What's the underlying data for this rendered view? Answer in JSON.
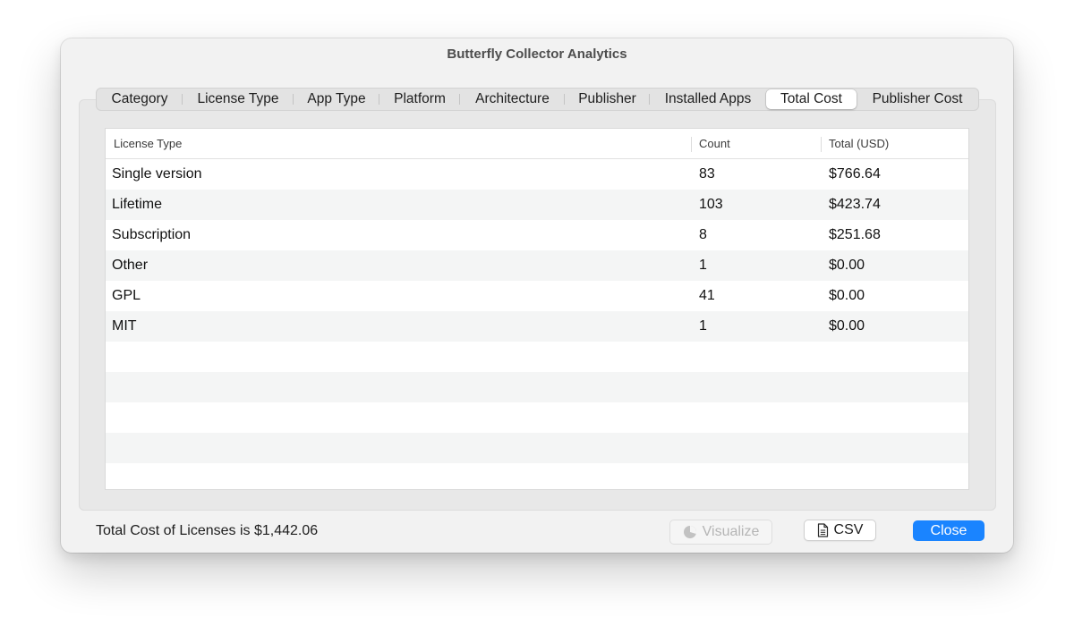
{
  "window": {
    "title": "Butterfly Collector Analytics"
  },
  "tabs": [
    {
      "label": "Category",
      "active": false
    },
    {
      "label": "License Type",
      "active": false
    },
    {
      "label": "App Type",
      "active": false
    },
    {
      "label": "Platform",
      "active": false
    },
    {
      "label": "Architecture",
      "active": false
    },
    {
      "label": "Publisher",
      "active": false
    },
    {
      "label": "Installed Apps",
      "active": false
    },
    {
      "label": "Total Cost",
      "active": true
    },
    {
      "label": "Publisher Cost",
      "active": false
    }
  ],
  "table": {
    "columns": [
      "License Type",
      "Count",
      "Total (USD)"
    ],
    "rows": [
      [
        "Single version",
        "83",
        "$766.64"
      ],
      [
        "Lifetime",
        "103",
        "$423.74"
      ],
      [
        "Subscription",
        "8",
        "$251.68"
      ],
      [
        "Other",
        "1",
        "$0.00"
      ],
      [
        "GPL",
        "41",
        "$0.00"
      ],
      [
        "MIT",
        "1",
        "$0.00"
      ],
      [
        "",
        "",
        ""
      ],
      [
        "",
        "",
        ""
      ],
      [
        "",
        "",
        ""
      ],
      [
        "",
        "",
        ""
      ],
      [
        "",
        "",
        ""
      ]
    ]
  },
  "footer": {
    "summary": "Total Cost of Licenses is $1,442.06",
    "visualize_label": "Visualize",
    "visualize_icon": "pie-chart-icon",
    "visualize_enabled": false,
    "csv_label": "CSV",
    "csv_icon": "document-icon",
    "close_label": "Close"
  },
  "colors": {
    "accent": "#1a84ff",
    "window_bg": "#f2f2f2",
    "row_alt": "#f4f5f5"
  }
}
